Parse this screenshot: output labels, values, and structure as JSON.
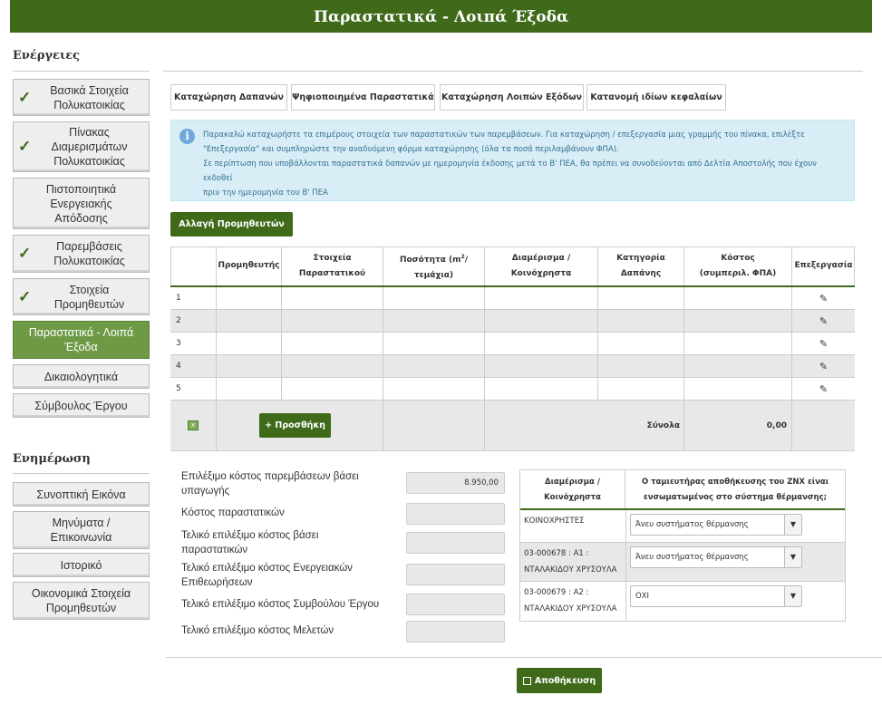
{
  "page": {
    "title": "Παραστατικά - Λοιπά Έξοδα"
  },
  "sidebar": {
    "actions_heading": "Ενέργειες",
    "actions": [
      {
        "label": "Βασικά Στοιχεία Πολυκατοικίας",
        "checked": true
      },
      {
        "label": "Πίνακας Διαμερισμάτων Πολυκατοικίας",
        "checked": true
      },
      {
        "label": "Πιστοποιητικά Ενεργειακής Απόδοσης",
        "checked": false
      },
      {
        "label": "Παρεμβάσεις Πολυκατοικίας",
        "checked": true
      },
      {
        "label": "Στοιχεία Προμηθευτών",
        "checked": true
      },
      {
        "label": "Παραστατικά - Λοιπά Έξοδα",
        "active": true
      },
      {
        "label": "Δικαιολογητικά"
      },
      {
        "label": "Σύμβουλος Έργου"
      }
    ],
    "info_heading": "Ενημέρωση",
    "info_items": [
      "Συνοπτική Εικόνα",
      "Μηνύματα / Επικοινωνία",
      "Ιστορικό",
      "Οικονομικά Στοιχεία Προμηθευτών"
    ]
  },
  "tabs": [
    "Καταχώρηση Δαπανών",
    "Ψηφιοποιημένα Παραστατικά",
    "Καταχώρηση Λοιπών Εξόδων",
    "Κατανομή ιδίων κεφαλαίων"
  ],
  "info_box": {
    "line1": "Παρακαλώ καταχωρήστε τα επιμέρους στοιχεία των παραστατικών των παρεμβάσεων. Για καταχώρηση / επεξεργασία μιας γραμμής του πίνακα, επιλέξτε",
    "line2": "\"Επεξεργασία\" και συμπληρώστε την αναδυόμενη φόρμα καταχώρησης (όλα τα ποσά περιλαμβάνουν ΦΠΑ).",
    "line3": "Σε περίπτωση που υποβάλλονται παραστατικά δαπανών με ημερομηνία έκδοσης μετά το Β' ΠΕΑ, θα πρέπει να συνοδεύονται από Δελτία Αποστολής που έχουν εκδοθεί",
    "line4": "πριν την ημερομηνία του Β' ΠΕΑ"
  },
  "change_suppliers_button": "Αλλαγή Προμηθευτών",
  "table": {
    "headers": {
      "supplier": "Προμηθευτής",
      "document": "Στοιχεία Παραστατικού",
      "quantity_pre": "Ποσότητα (m",
      "quantity_sup": "2",
      "quantity_post": "/ τεμάχια)",
      "apartment": "Διαμέρισμα / Κοινόχρηστα",
      "category": "Κατηγορία Δαπάνης",
      "cost": "Κόστος (συμπεριλ. ΦΠΑ)",
      "edit": "Επεξεργασία"
    },
    "rows": [
      "1",
      "2",
      "3",
      "4",
      "5"
    ],
    "add_button": "+ Προσθήκη",
    "totals_label": "Σύνολα",
    "totals_value": "0,00"
  },
  "costs": [
    {
      "label": "Επιλέξιμο κόστος παρεμβάσεων βάσει υπαγωγής",
      "value": "8.950,00"
    },
    {
      "label": "Κόστος παραστατικών",
      "value": ""
    },
    {
      "label": "Τελικό επιλέξιμο κόστος βάσει παραστατικών",
      "value": ""
    },
    {
      "label": "Τελικό επιλέξιμο κόστος Ενεργειακών Επιθεωρήσεων",
      "value": ""
    },
    {
      "label": "Τελικό επιλέξιμο κόστος Συμβούλου Έργου",
      "value": ""
    },
    {
      "label": "Τελικό επιλέξιμο κόστος Μελετών",
      "value": ""
    }
  ],
  "heating": {
    "header_left": "Διαμέρισμα / Κοινόχρηστα",
    "header_right": "Ο ταμιευτήρας αποθήκευσης του ΖΝΧ είναι ενσωματωμένος στο σύστημα θέρμανσης;",
    "rows": [
      {
        "line1": "ΚΟΙΝΟΧΡΗΣΤΕΣ",
        "line2": "",
        "value": "Άνευ συστήματος θέρμανσης"
      },
      {
        "line1": "03-000678 : A1 :",
        "line2": "ΝΤΑΛΑΚΙΔΟΥ ΧΡΥΣΟΥΛΑ",
        "value": "Άνευ συστήματος θέρμανσης"
      },
      {
        "line1": "03-000679 : A2 :",
        "line2": "ΝΤΑΛΑΚΙΔΟΥ ΧΡΥΣΟΥΛΑ",
        "value": "ΟΧΙ"
      }
    ]
  },
  "save_button": "Αποθήκευση",
  "colors": {
    "primary": "#3f6a1a",
    "active_nav": "#6e9a46",
    "info_bg": "#d9edf7"
  }
}
